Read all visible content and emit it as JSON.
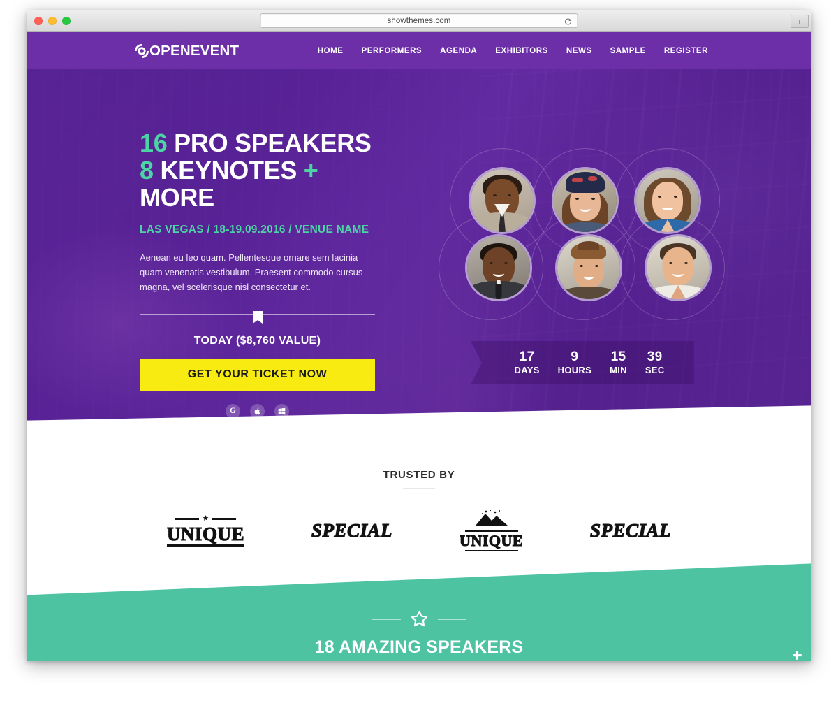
{
  "browser": {
    "url": "showthemes.com",
    "reload_icon": "reload-icon",
    "new_tab_label": "+",
    "traffic_lights": [
      "close",
      "minimize",
      "zoom"
    ]
  },
  "site": {
    "logo_text": "OPENEVENT",
    "logo_icon": "open-circle-logo-icon",
    "nav": [
      {
        "label": "HOME"
      },
      {
        "label": "PERFORMERS"
      },
      {
        "label": "AGENDA"
      },
      {
        "label": "EXHIBITORS"
      },
      {
        "label": "NEWS"
      },
      {
        "label": "SAMPLE"
      },
      {
        "label": "REGISTER"
      }
    ]
  },
  "hero": {
    "headline_line1_accent": "16",
    "headline_line1_rest": "PRO SPEAKERS",
    "headline_line2_accent": "8",
    "headline_line2_rest": "KEYNOTES",
    "headline_line2_plus": "+",
    "headline_line2_more": "MORE",
    "subhead": "LAS VEGAS / 18-19.09.2016 / VENUE NAME",
    "paragraph": "Aenean eu leo quam. Pellentesque ornare sem lacinia quam venenatis vestibulum. Praesent commodo cursus magna, vel scelerisque nisl consectetur et.",
    "divider_icon": "bookmark-icon",
    "today_label": "TODAY ($8,760 VALUE)",
    "cta_label": "GET YOUR TICKET NOW",
    "social": [
      {
        "name": "google-icon",
        "glyph": "G"
      },
      {
        "name": "apple-icon",
        "glyph": ""
      },
      {
        "name": "windows-icon",
        "glyph": ""
      }
    ],
    "speakers": [
      {
        "alt": "speaker-portrait-1"
      },
      {
        "alt": "speaker-portrait-2"
      },
      {
        "alt": "speaker-portrait-3"
      },
      {
        "alt": "speaker-portrait-4"
      },
      {
        "alt": "speaker-portrait-5"
      },
      {
        "alt": "speaker-portrait-6"
      }
    ],
    "countdown": [
      {
        "value": "17",
        "unit": "DAYS"
      },
      {
        "value": "9",
        "unit": "HOURS"
      },
      {
        "value": "15",
        "unit": "MIN"
      },
      {
        "value": "39",
        "unit": "SEC"
      }
    ]
  },
  "trusted": {
    "title": "TRUSTED BY",
    "logos": [
      {
        "name": "UNIQUE",
        "style": "unique-banner"
      },
      {
        "name": "SPECIAL",
        "style": "special-slab"
      },
      {
        "name": "UNIQUE",
        "style": "unique-mountain"
      },
      {
        "name": "SPECIAL",
        "style": "special-slab"
      }
    ]
  },
  "speakers_section": {
    "divider_icon": "star-icon",
    "title": "18 AMAZING SPEAKERS",
    "corner_icon": "plus-icon"
  },
  "colors": {
    "purple_nav": "#6c2fa8",
    "purple_hero": "#7a38b4",
    "green_accent": "#4dd4a4",
    "green_section": "#4dc3a2",
    "yellow_cta": "#f7eb12",
    "white": "#ffffff"
  }
}
